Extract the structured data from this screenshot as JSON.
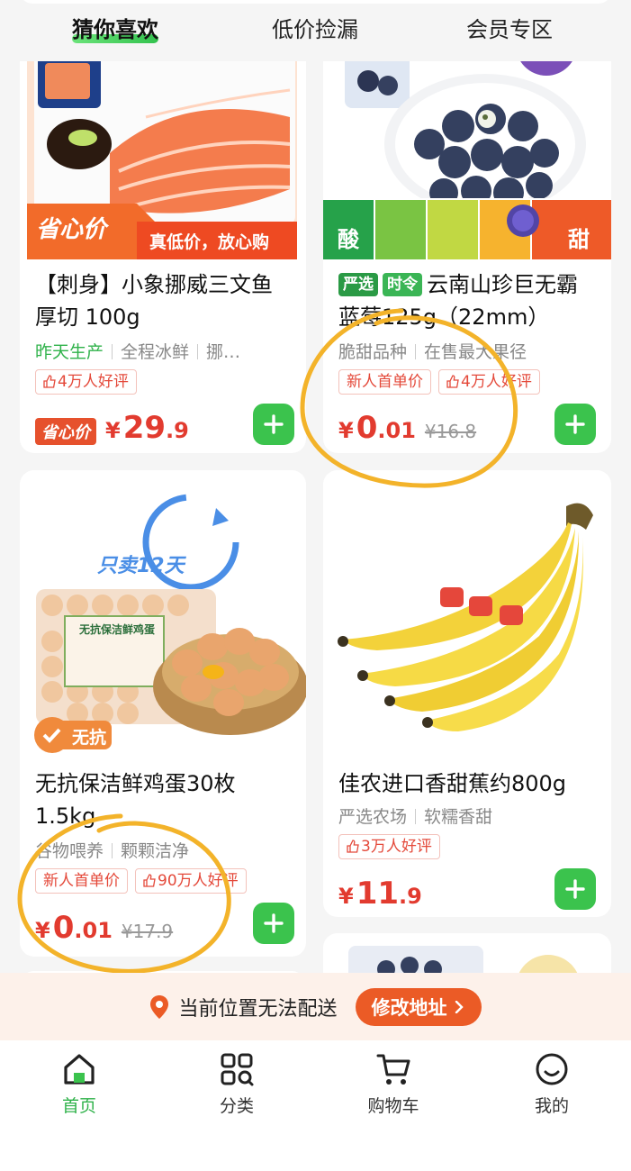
{
  "tabs": [
    "猜你喜欢",
    "低价捡漏",
    "会员专区"
  ],
  "products": [
    {
      "title": "【刺身】小象挪威三文鱼厚切 100g",
      "tags": [
        "昨天生产",
        "全程冰鲜",
        "挪…"
      ],
      "chips": [
        "4万人好评"
      ],
      "badge": "省心价",
      "price": {
        "yen": "¥",
        "int": "29",
        "dec": ".9"
      },
      "image": {
        "banner_left": "省心价",
        "banner_right": "真低价，放心购"
      }
    },
    {
      "badges": [
        "严选",
        "时令"
      ],
      "title": "云南山珍巨无霸蓝莓125g（22mm）",
      "tags": [
        "脆甜品种",
        "在售最大果径"
      ],
      "chips": [
        "新人首单价",
        "4万人好评"
      ],
      "price": {
        "yen": "¥",
        "int": "0",
        "dec": ".01",
        "old": "¥16.8"
      },
      "image": {
        "scale_left": "酸",
        "scale_right": "甜"
      }
    },
    {
      "title": "无抗保洁鲜鸡蛋30枚 1.5kg",
      "tags": [
        "谷物喂养",
        "颗颗洁净"
      ],
      "chips": [
        "新人首单价",
        "90万人好评"
      ],
      "price": {
        "yen": "¥",
        "int": "0",
        "dec": ".01",
        "old": "¥17.9"
      },
      "image": {
        "promo": "只卖12天",
        "badge": "无抗",
        "box_label": "无抗保洁鲜鸡蛋"
      }
    },
    {
      "title": "佳农进口香甜蕉约800g",
      "tags": [
        "严选农场",
        "软糯香甜"
      ],
      "chips": [
        "3万人好评"
      ],
      "price": {
        "yen": "¥",
        "int": "11",
        "dec": ".9"
      }
    }
  ],
  "location_bar": {
    "message": "当前位置无法配送",
    "button": "修改地址"
  },
  "bottom_nav": [
    "首页",
    "分类",
    "购物车",
    "我的"
  ],
  "colors": {
    "accent": "#3bc34d",
    "price": "#e23b2f",
    "annotation": "#f3b32a"
  }
}
